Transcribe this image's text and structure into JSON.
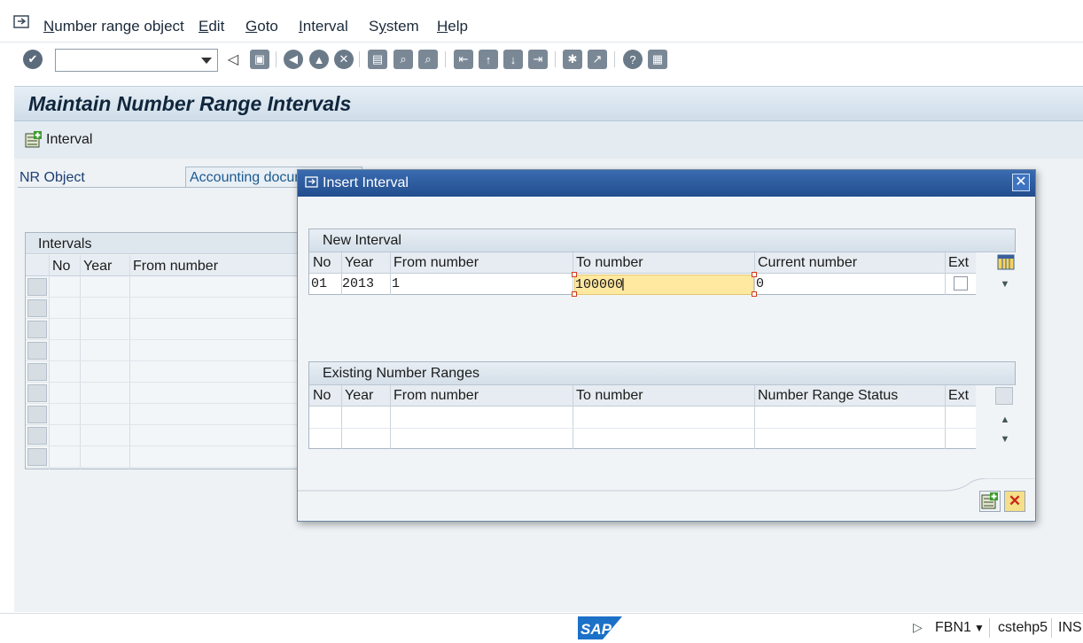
{
  "menu": {
    "items": [
      "Number range object",
      "Edit",
      "Goto",
      "Interval",
      "System",
      "Help"
    ],
    "mnemonics": [
      "N",
      "E",
      "G",
      "I",
      "y",
      "H"
    ]
  },
  "toolbar": {
    "command_field_value": "",
    "icons": [
      "enter-icon",
      "back-arrow-icon",
      "save-icon",
      "back-icon",
      "exit-icon",
      "cancel-icon",
      "print-icon",
      "find-icon",
      "find-next-icon",
      "first-page-icon",
      "previous-page-icon",
      "next-page-icon",
      "last-page-icon",
      "create-session-icon",
      "shortcut-icon",
      "help-icon",
      "layout-menu-icon"
    ]
  },
  "page": {
    "title": "Maintain Number Range Intervals",
    "app_button_label": "Interval",
    "nr_object_label": "NR Object",
    "nr_object_value": "Accounting document"
  },
  "bg_intervals": {
    "caption": "Intervals",
    "columns": [
      "No",
      "Year",
      "From number"
    ]
  },
  "dialog": {
    "title": "Insert Interval",
    "new_interval": {
      "caption": "New Interval",
      "columns": [
        "No",
        "Year",
        "From number",
        "To number",
        "Current number",
        "Ext"
      ],
      "row": {
        "no": "01",
        "year": "2013",
        "from": "1",
        "to": "100000",
        "current": "0",
        "ext": false
      }
    },
    "existing": {
      "caption": "Existing Number Ranges",
      "columns": [
        "No",
        "Year",
        "From number",
        "To number",
        "Number Range Status",
        "Ext"
      ]
    }
  },
  "status": {
    "logo_text": "SAP",
    "transaction": "FBN1",
    "server": "cstehp5",
    "mode": "INS"
  },
  "colors": {
    "dialog_title": "#224d8d",
    "active_field": "#ffe8a0",
    "link_blue": "#1c3e74"
  }
}
